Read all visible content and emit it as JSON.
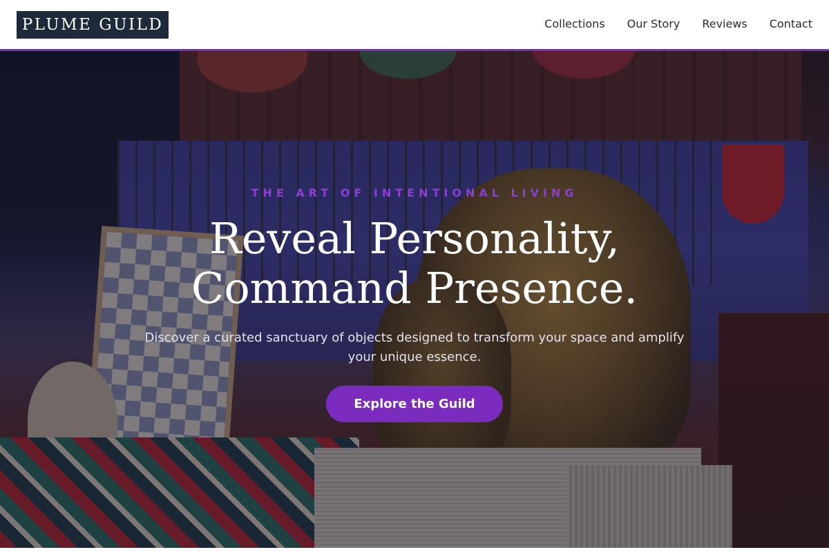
{
  "header": {
    "logo": "PLUME GUILD",
    "nav": [
      "Collections",
      "Our Story",
      "Reviews",
      "Contact"
    ]
  },
  "hero": {
    "eyebrow": "THE ART OF INTENTIONAL LIVING",
    "headline_line1": "Reveal Personality,",
    "headline_line2": "Command Presence.",
    "subtitle": "Discover a curated sanctuary of objects designed to transform your space and amplify your unique essence.",
    "cta_label": "Explore the Guild"
  },
  "colors": {
    "accent": "#7b2cbf",
    "logo_bg": "#1e2a3a",
    "text_dark": "#2b2b2b",
    "text_light": "#ffffff"
  }
}
